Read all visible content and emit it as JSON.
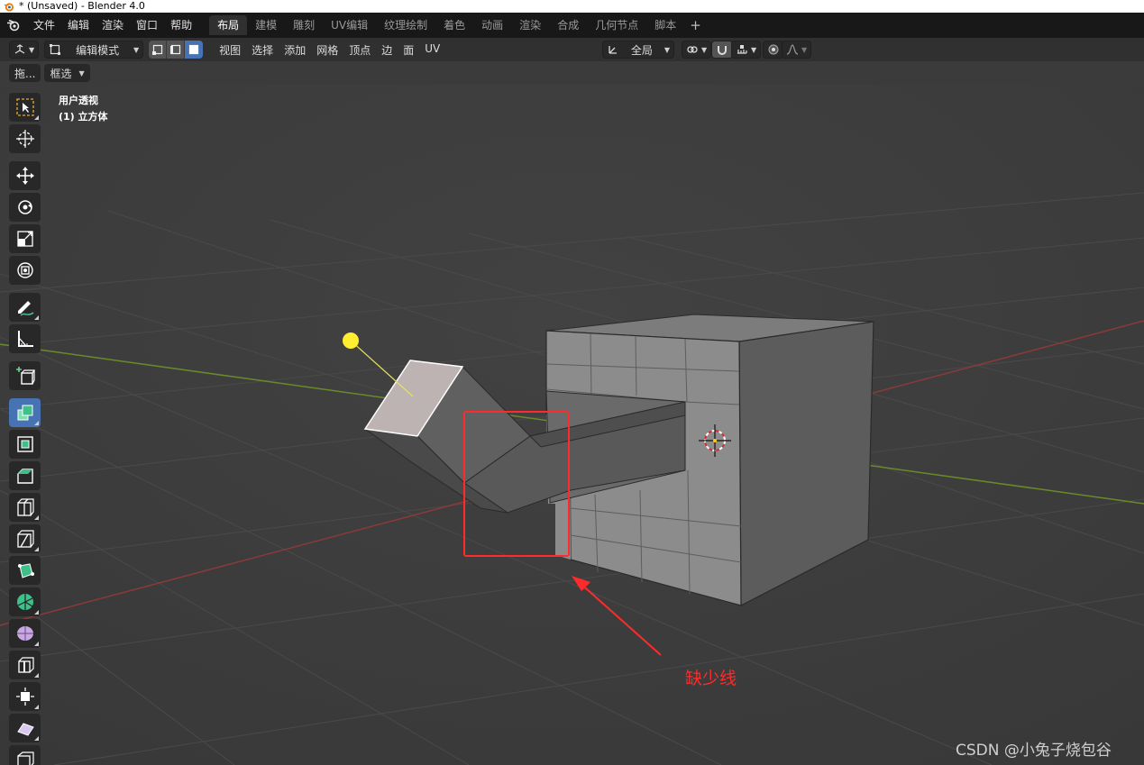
{
  "window": {
    "title": "* (Unsaved) - Blender 4.0"
  },
  "menubar": {
    "items": [
      "文件",
      "编辑",
      "渲染",
      "窗口",
      "帮助"
    ]
  },
  "workspaces": {
    "tabs": [
      "布局",
      "建模",
      "雕刻",
      "UV编辑",
      "纹理绘制",
      "着色",
      "动画",
      "渲染",
      "合成",
      "几何节点",
      "脚本"
    ],
    "active_index": 0,
    "add_label": "+"
  },
  "header": {
    "mode_label": "编辑模式",
    "menus": [
      "视图",
      "选择",
      "添加",
      "网格",
      "顶点",
      "边",
      "面",
      "UV"
    ],
    "orientation_label": "全局"
  },
  "tool_header": {
    "drag_label": "拖...",
    "select_label": "框选"
  },
  "viewport": {
    "view_name": "用户透视",
    "object_name": "(1) 立方体"
  },
  "annotation": {
    "label": "缺少线",
    "color": "#ff2a2a"
  },
  "watermark": {
    "text": "CSDN @小兔子烧包谷"
  },
  "toolbar": {
    "tools": [
      "select-box-tool",
      "cursor-tool",
      "move-tool",
      "rotate-tool",
      "scale-tool",
      "transform-tool",
      "annotate-tool",
      "measure-tool",
      "add-cube-tool",
      "extrude-tool",
      "inset-tool",
      "bevel-tool",
      "loop-cut-tool",
      "knife-tool",
      "poly-build-tool",
      "spin-tool",
      "smooth-tool",
      "edge-slide-tool",
      "shrink-fatten-tool",
      "shear-tool",
      "rip-tool"
    ],
    "active_tool": "extrude-tool"
  },
  "colors": {
    "accent": "#4772b3",
    "x_axis": "#8a3a3a",
    "y_axis": "#6a8a2a"
  }
}
